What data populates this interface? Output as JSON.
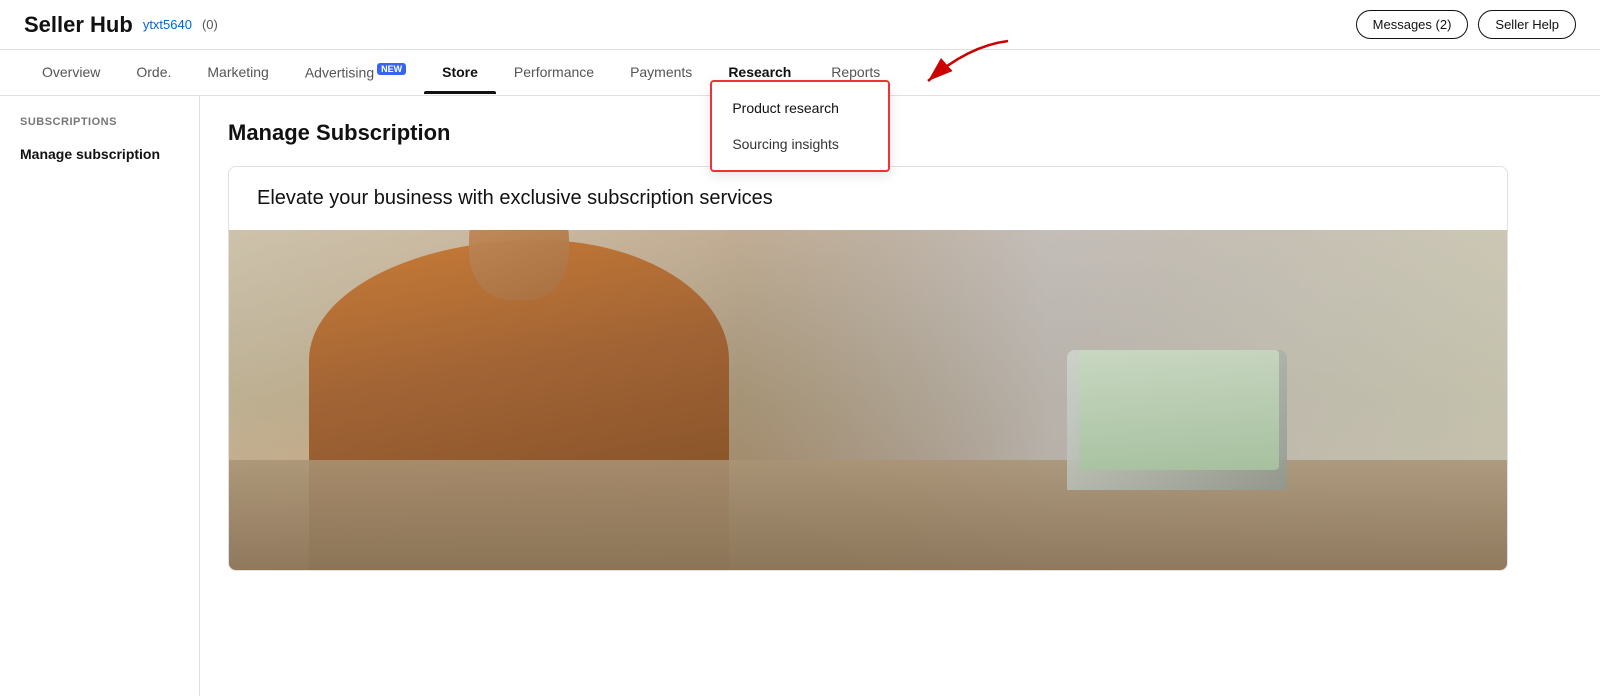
{
  "header": {
    "site_title": "Seller Hub",
    "user_link": "ytxt5640",
    "notification": "(0)",
    "messages_btn": "Messages (2)",
    "help_btn": "Seller Help"
  },
  "nav": {
    "items": [
      {
        "label": "Overview",
        "active": false,
        "badge": ""
      },
      {
        "label": "Orde.",
        "active": false,
        "badge": ""
      },
      {
        "label": "Marketing",
        "active": false,
        "badge": ""
      },
      {
        "label": "Advertising",
        "active": false,
        "badge": "NEW"
      },
      {
        "label": "Store",
        "active": true,
        "badge": ""
      },
      {
        "label": "Performance",
        "active": false,
        "badge": ""
      },
      {
        "label": "Payments",
        "active": false,
        "badge": ""
      },
      {
        "label": "Research",
        "active": false,
        "badge": "",
        "highlighted": true
      },
      {
        "label": "Reports",
        "active": false,
        "badge": ""
      }
    ]
  },
  "research_dropdown": {
    "items": [
      {
        "label": "Product research",
        "highlighted": true
      },
      {
        "label": "Sourcing insights",
        "highlighted": false
      }
    ]
  },
  "sidebar": {
    "section_label": "SUBSCRIPTIONS",
    "items": [
      {
        "label": "Manage subscription"
      }
    ]
  },
  "main": {
    "page_title": "Manage Subscription",
    "hero_text": "Elevate your business with exclusive subscription services"
  }
}
